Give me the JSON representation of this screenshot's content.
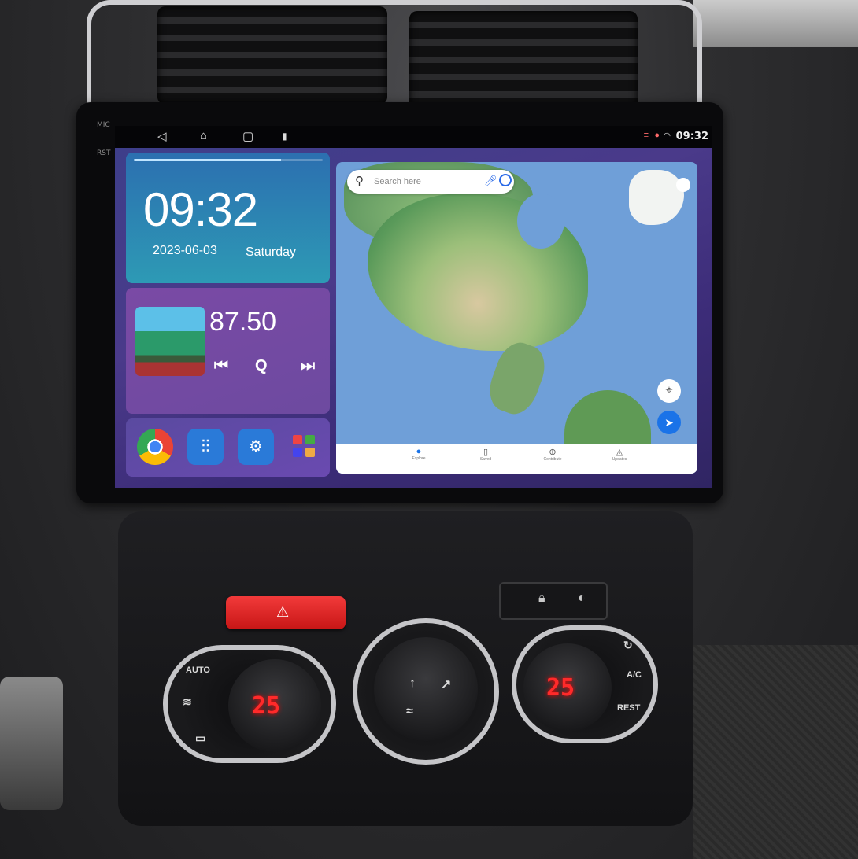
{
  "head_unit": {
    "bezel_labels": {
      "mic": "MIC",
      "rst": "RST"
    },
    "status_bar": {
      "nav_icons": [
        "back-icon",
        "home-icon",
        "recents-icon",
        "notification-icon"
      ],
      "time": "09:32",
      "status_icons": [
        "signal-icon",
        "location-icon",
        "wifi-icon"
      ]
    },
    "clock_widget": {
      "time": "09:32",
      "date": "2023-06-03",
      "weekday": "Saturday"
    },
    "radio_widget": {
      "frequency": "87.50",
      "controls": [
        "previous-icon",
        "search-icon",
        "next-icon"
      ]
    },
    "app_dock": {
      "apps": [
        "chrome-icon",
        "equalizer-icon",
        "car-settings-icon",
        "apps-grid-icon"
      ]
    },
    "map": {
      "search_placeholder": "Search here",
      "tabs": [
        {
          "icon": "explore-icon",
          "label": "Explore"
        },
        {
          "icon": "saved-icon",
          "label": "Saved"
        },
        {
          "icon": "contribute-icon",
          "label": "Contribute"
        },
        {
          "icon": "updates-icon",
          "label": "Updates"
        }
      ]
    }
  },
  "climate": {
    "left_temp": "25",
    "right_temp": "25",
    "left_buttons": [
      "AUTO",
      "",
      ""
    ],
    "right_buttons": [
      "",
      "A/C",
      "REST"
    ]
  },
  "colors": {
    "clock_card": "#2c8fb5",
    "radio_card": "#7a4aa5",
    "temp_display": "#ff2a2a",
    "hazard": "#e02020",
    "map_water": "#6f9fd8"
  }
}
